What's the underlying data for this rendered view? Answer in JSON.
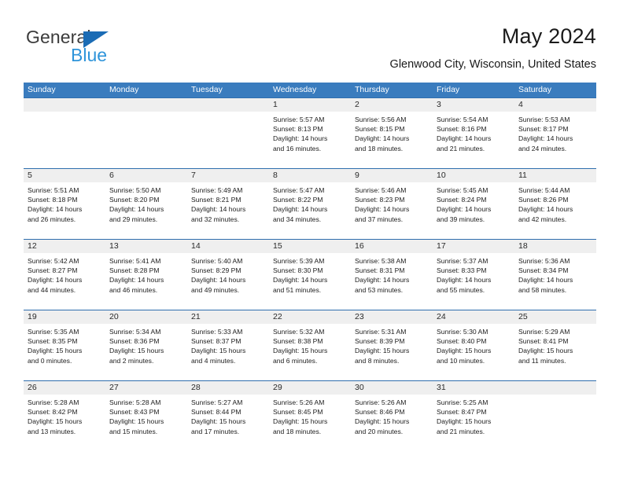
{
  "brand": {
    "name_part1": "General",
    "name_part2": "Blue",
    "flag_icon": "triangle-flag-icon",
    "colors": {
      "general_text": "#3b3b3b",
      "blue_text": "#2e94da",
      "flag": "#1b6cb5"
    }
  },
  "header": {
    "title": "May 2024",
    "subtitle": "Glenwood City, Wisconsin, United States"
  },
  "theme": {
    "header_blue": "#3a7cbe",
    "rule_blue": "#2f6eae",
    "daynum_band": "#efefef",
    "text": "#1d1d1d"
  },
  "weekdays": [
    "Sunday",
    "Monday",
    "Tuesday",
    "Wednesday",
    "Thursday",
    "Friday",
    "Saturday"
  ],
  "weeks": [
    {
      "days": [
        {
          "num": "",
          "empty": true,
          "sunrise": "",
          "sunset": "",
          "daylight1": "",
          "daylight2": ""
        },
        {
          "num": "",
          "empty": true,
          "sunrise": "",
          "sunset": "",
          "daylight1": "",
          "daylight2": ""
        },
        {
          "num": "",
          "empty": true,
          "sunrise": "",
          "sunset": "",
          "daylight1": "",
          "daylight2": ""
        },
        {
          "num": "1",
          "empty": false,
          "sunrise": "Sunrise: 5:57 AM",
          "sunset": "Sunset: 8:13 PM",
          "daylight1": "Daylight: 14 hours",
          "daylight2": "and 16 minutes."
        },
        {
          "num": "2",
          "empty": false,
          "sunrise": "Sunrise: 5:56 AM",
          "sunset": "Sunset: 8:15 PM",
          "daylight1": "Daylight: 14 hours",
          "daylight2": "and 18 minutes."
        },
        {
          "num": "3",
          "empty": false,
          "sunrise": "Sunrise: 5:54 AM",
          "sunset": "Sunset: 8:16 PM",
          "daylight1": "Daylight: 14 hours",
          "daylight2": "and 21 minutes."
        },
        {
          "num": "4",
          "empty": false,
          "sunrise": "Sunrise: 5:53 AM",
          "sunset": "Sunset: 8:17 PM",
          "daylight1": "Daylight: 14 hours",
          "daylight2": "and 24 minutes."
        }
      ]
    },
    {
      "days": [
        {
          "num": "5",
          "empty": false,
          "sunrise": "Sunrise: 5:51 AM",
          "sunset": "Sunset: 8:18 PM",
          "daylight1": "Daylight: 14 hours",
          "daylight2": "and 26 minutes."
        },
        {
          "num": "6",
          "empty": false,
          "sunrise": "Sunrise: 5:50 AM",
          "sunset": "Sunset: 8:20 PM",
          "daylight1": "Daylight: 14 hours",
          "daylight2": "and 29 minutes."
        },
        {
          "num": "7",
          "empty": false,
          "sunrise": "Sunrise: 5:49 AM",
          "sunset": "Sunset: 8:21 PM",
          "daylight1": "Daylight: 14 hours",
          "daylight2": "and 32 minutes."
        },
        {
          "num": "8",
          "empty": false,
          "sunrise": "Sunrise: 5:47 AM",
          "sunset": "Sunset: 8:22 PM",
          "daylight1": "Daylight: 14 hours",
          "daylight2": "and 34 minutes."
        },
        {
          "num": "9",
          "empty": false,
          "sunrise": "Sunrise: 5:46 AM",
          "sunset": "Sunset: 8:23 PM",
          "daylight1": "Daylight: 14 hours",
          "daylight2": "and 37 minutes."
        },
        {
          "num": "10",
          "empty": false,
          "sunrise": "Sunrise: 5:45 AM",
          "sunset": "Sunset: 8:24 PM",
          "daylight1": "Daylight: 14 hours",
          "daylight2": "and 39 minutes."
        },
        {
          "num": "11",
          "empty": false,
          "sunrise": "Sunrise: 5:44 AM",
          "sunset": "Sunset: 8:26 PM",
          "daylight1": "Daylight: 14 hours",
          "daylight2": "and 42 minutes."
        }
      ]
    },
    {
      "days": [
        {
          "num": "12",
          "empty": false,
          "sunrise": "Sunrise: 5:42 AM",
          "sunset": "Sunset: 8:27 PM",
          "daylight1": "Daylight: 14 hours",
          "daylight2": "and 44 minutes."
        },
        {
          "num": "13",
          "empty": false,
          "sunrise": "Sunrise: 5:41 AM",
          "sunset": "Sunset: 8:28 PM",
          "daylight1": "Daylight: 14 hours",
          "daylight2": "and 46 minutes."
        },
        {
          "num": "14",
          "empty": false,
          "sunrise": "Sunrise: 5:40 AM",
          "sunset": "Sunset: 8:29 PM",
          "daylight1": "Daylight: 14 hours",
          "daylight2": "and 49 minutes."
        },
        {
          "num": "15",
          "empty": false,
          "sunrise": "Sunrise: 5:39 AM",
          "sunset": "Sunset: 8:30 PM",
          "daylight1": "Daylight: 14 hours",
          "daylight2": "and 51 minutes."
        },
        {
          "num": "16",
          "empty": false,
          "sunrise": "Sunrise: 5:38 AM",
          "sunset": "Sunset: 8:31 PM",
          "daylight1": "Daylight: 14 hours",
          "daylight2": "and 53 minutes."
        },
        {
          "num": "17",
          "empty": false,
          "sunrise": "Sunrise: 5:37 AM",
          "sunset": "Sunset: 8:33 PM",
          "daylight1": "Daylight: 14 hours",
          "daylight2": "and 55 minutes."
        },
        {
          "num": "18",
          "empty": false,
          "sunrise": "Sunrise: 5:36 AM",
          "sunset": "Sunset: 8:34 PM",
          "daylight1": "Daylight: 14 hours",
          "daylight2": "and 58 minutes."
        }
      ]
    },
    {
      "days": [
        {
          "num": "19",
          "empty": false,
          "sunrise": "Sunrise: 5:35 AM",
          "sunset": "Sunset: 8:35 PM",
          "daylight1": "Daylight: 15 hours",
          "daylight2": "and 0 minutes."
        },
        {
          "num": "20",
          "empty": false,
          "sunrise": "Sunrise: 5:34 AM",
          "sunset": "Sunset: 8:36 PM",
          "daylight1": "Daylight: 15 hours",
          "daylight2": "and 2 minutes."
        },
        {
          "num": "21",
          "empty": false,
          "sunrise": "Sunrise: 5:33 AM",
          "sunset": "Sunset: 8:37 PM",
          "daylight1": "Daylight: 15 hours",
          "daylight2": "and 4 minutes."
        },
        {
          "num": "22",
          "empty": false,
          "sunrise": "Sunrise: 5:32 AM",
          "sunset": "Sunset: 8:38 PM",
          "daylight1": "Daylight: 15 hours",
          "daylight2": "and 6 minutes."
        },
        {
          "num": "23",
          "empty": false,
          "sunrise": "Sunrise: 5:31 AM",
          "sunset": "Sunset: 8:39 PM",
          "daylight1": "Daylight: 15 hours",
          "daylight2": "and 8 minutes."
        },
        {
          "num": "24",
          "empty": false,
          "sunrise": "Sunrise: 5:30 AM",
          "sunset": "Sunset: 8:40 PM",
          "daylight1": "Daylight: 15 hours",
          "daylight2": "and 10 minutes."
        },
        {
          "num": "25",
          "empty": false,
          "sunrise": "Sunrise: 5:29 AM",
          "sunset": "Sunset: 8:41 PM",
          "daylight1": "Daylight: 15 hours",
          "daylight2": "and 11 minutes."
        }
      ]
    },
    {
      "days": [
        {
          "num": "26",
          "empty": false,
          "sunrise": "Sunrise: 5:28 AM",
          "sunset": "Sunset: 8:42 PM",
          "daylight1": "Daylight: 15 hours",
          "daylight2": "and 13 minutes."
        },
        {
          "num": "27",
          "empty": false,
          "sunrise": "Sunrise: 5:28 AM",
          "sunset": "Sunset: 8:43 PM",
          "daylight1": "Daylight: 15 hours",
          "daylight2": "and 15 minutes."
        },
        {
          "num": "28",
          "empty": false,
          "sunrise": "Sunrise: 5:27 AM",
          "sunset": "Sunset: 8:44 PM",
          "daylight1": "Daylight: 15 hours",
          "daylight2": "and 17 minutes."
        },
        {
          "num": "29",
          "empty": false,
          "sunrise": "Sunrise: 5:26 AM",
          "sunset": "Sunset: 8:45 PM",
          "daylight1": "Daylight: 15 hours",
          "daylight2": "and 18 minutes."
        },
        {
          "num": "30",
          "empty": false,
          "sunrise": "Sunrise: 5:26 AM",
          "sunset": "Sunset: 8:46 PM",
          "daylight1": "Daylight: 15 hours",
          "daylight2": "and 20 minutes."
        },
        {
          "num": "31",
          "empty": false,
          "sunrise": "Sunrise: 5:25 AM",
          "sunset": "Sunset: 8:47 PM",
          "daylight1": "Daylight: 15 hours",
          "daylight2": "and 21 minutes."
        },
        {
          "num": "",
          "empty": true,
          "sunrise": "",
          "sunset": "",
          "daylight1": "",
          "daylight2": ""
        }
      ]
    }
  ]
}
